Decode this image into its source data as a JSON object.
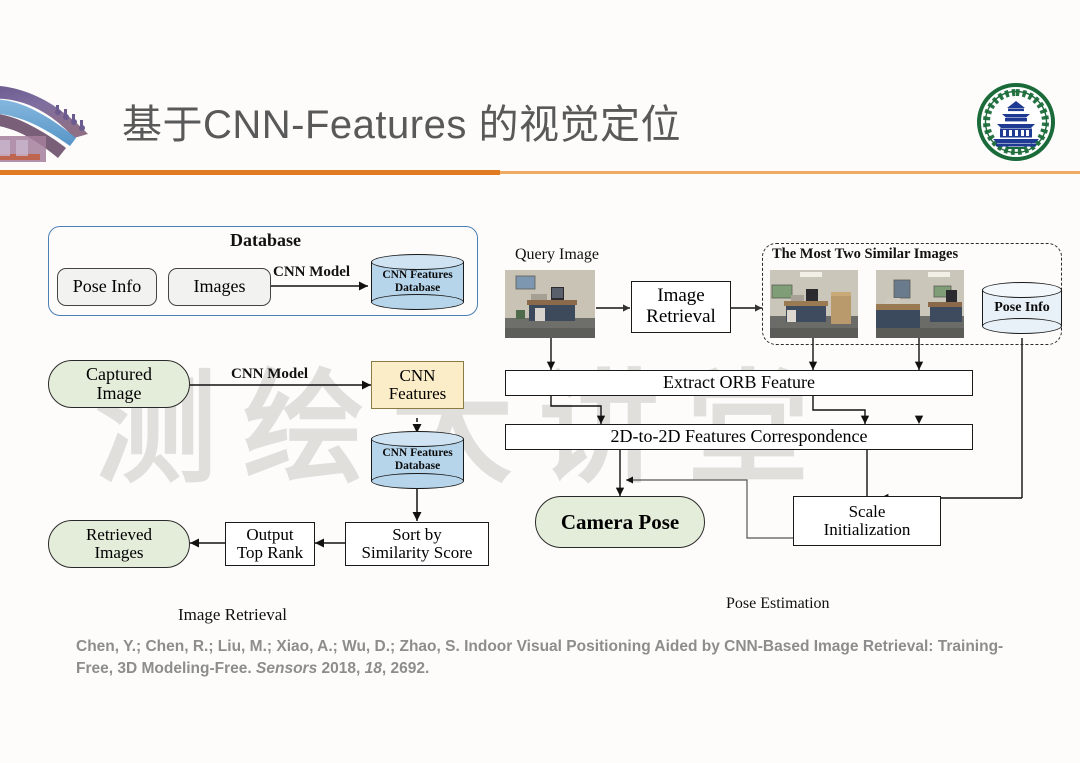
{
  "header": {
    "title": "基于CNN-Features 的视觉定位",
    "logo_alt": "wuhan-university-seal",
    "decoration_alt": "pagoda-roof-photo",
    "accent_color": "#e07b22",
    "accent_color_light": "#f0ab62",
    "title_color": "#595959"
  },
  "watermark": {
    "text": "测绘大讲堂",
    "color": "#dfdedb"
  },
  "diagram": {
    "left_section": {
      "caption": "Image Retrieval",
      "database_group": {
        "title": "Database",
        "nodes": [
          {
            "id": "pose-info",
            "label": "Pose Info",
            "shape": "rounded-rect"
          },
          {
            "id": "images",
            "label": "Images",
            "shape": "rounded-rect"
          },
          {
            "id": "cnn-features-database",
            "label_line1": "CNN Features",
            "label_line2": "Database",
            "shape": "cylinder"
          }
        ],
        "edge_label": "CNN Model",
        "border_color": "#4a7fb5"
      },
      "nodes": [
        {
          "id": "captured-image",
          "label_line1": "Captured",
          "label_line2": "Image",
          "shape": "oval",
          "fill": "#e4edda"
        },
        {
          "id": "cnn-features",
          "label_line1": "CNN",
          "label_line2": "Features",
          "shape": "rect",
          "fill": "#fbedc8"
        },
        {
          "id": "cnn-features-db-2",
          "label_line1": "CNN Features",
          "label_line2": "Database",
          "shape": "cylinder",
          "fill": "#b6d4ea"
        },
        {
          "id": "sort-by-similarity-score",
          "label_line1": "Sort by",
          "label_line2": "Similarity Score",
          "shape": "rect"
        },
        {
          "id": "output-top-rank",
          "label_line1": "Output",
          "label_line2": "Top Rank",
          "shape": "rect"
        },
        {
          "id": "retrieved-images",
          "label_line1": "Retrieved",
          "label_line2": "Images",
          "shape": "oval",
          "fill": "#e4edda"
        }
      ],
      "edge_label_cnn_model": "CNN Model"
    },
    "right_section": {
      "caption": "Pose Estimation",
      "query_image_label": "Query Image",
      "similar_group_title": "The Most Two Similar Images",
      "nodes": [
        {
          "id": "image-retrieval",
          "label_line1": "Image",
          "label_line2": "Retrieval",
          "shape": "rect"
        },
        {
          "id": "pose-info-cylinder",
          "label": "Pose Info",
          "shape": "cylinder",
          "fill": "#e8f1f8"
        },
        {
          "id": "extract-orb-feature",
          "label": "Extract ORB Feature",
          "shape": "rect"
        },
        {
          "id": "2d-to-2d-features-correspondence",
          "label": "2D-to-2D Features Correspondence",
          "shape": "rect"
        },
        {
          "id": "camera-pose",
          "label": "Camera Pose",
          "shape": "oval",
          "fill": "#e4edda",
          "bold": true
        },
        {
          "id": "scale-initialization",
          "label_line1": "Scale",
          "label_line2": "Initialization",
          "shape": "rect"
        }
      ],
      "photos": [
        {
          "id": "query-image-photo",
          "alt": "office-desk-photo"
        },
        {
          "id": "similar-image-1",
          "alt": "office-room-photo-1"
        },
        {
          "id": "similar-image-2",
          "alt": "office-room-photo-2"
        }
      ]
    }
  },
  "citation": {
    "part1": "Chen, Y.; Chen, R.; Liu, M.; Xiao, A.; Wu, D.; Zhao, S. Indoor Visual Positioning Aided by CNN-Based Image Retrieval: Training-Free, 3D Modeling-Free. ",
    "journal": "Sensors",
    "part2": " 2018, ",
    "volume": "18",
    "part3": ", 2692.",
    "color": "#8d8d8d"
  }
}
